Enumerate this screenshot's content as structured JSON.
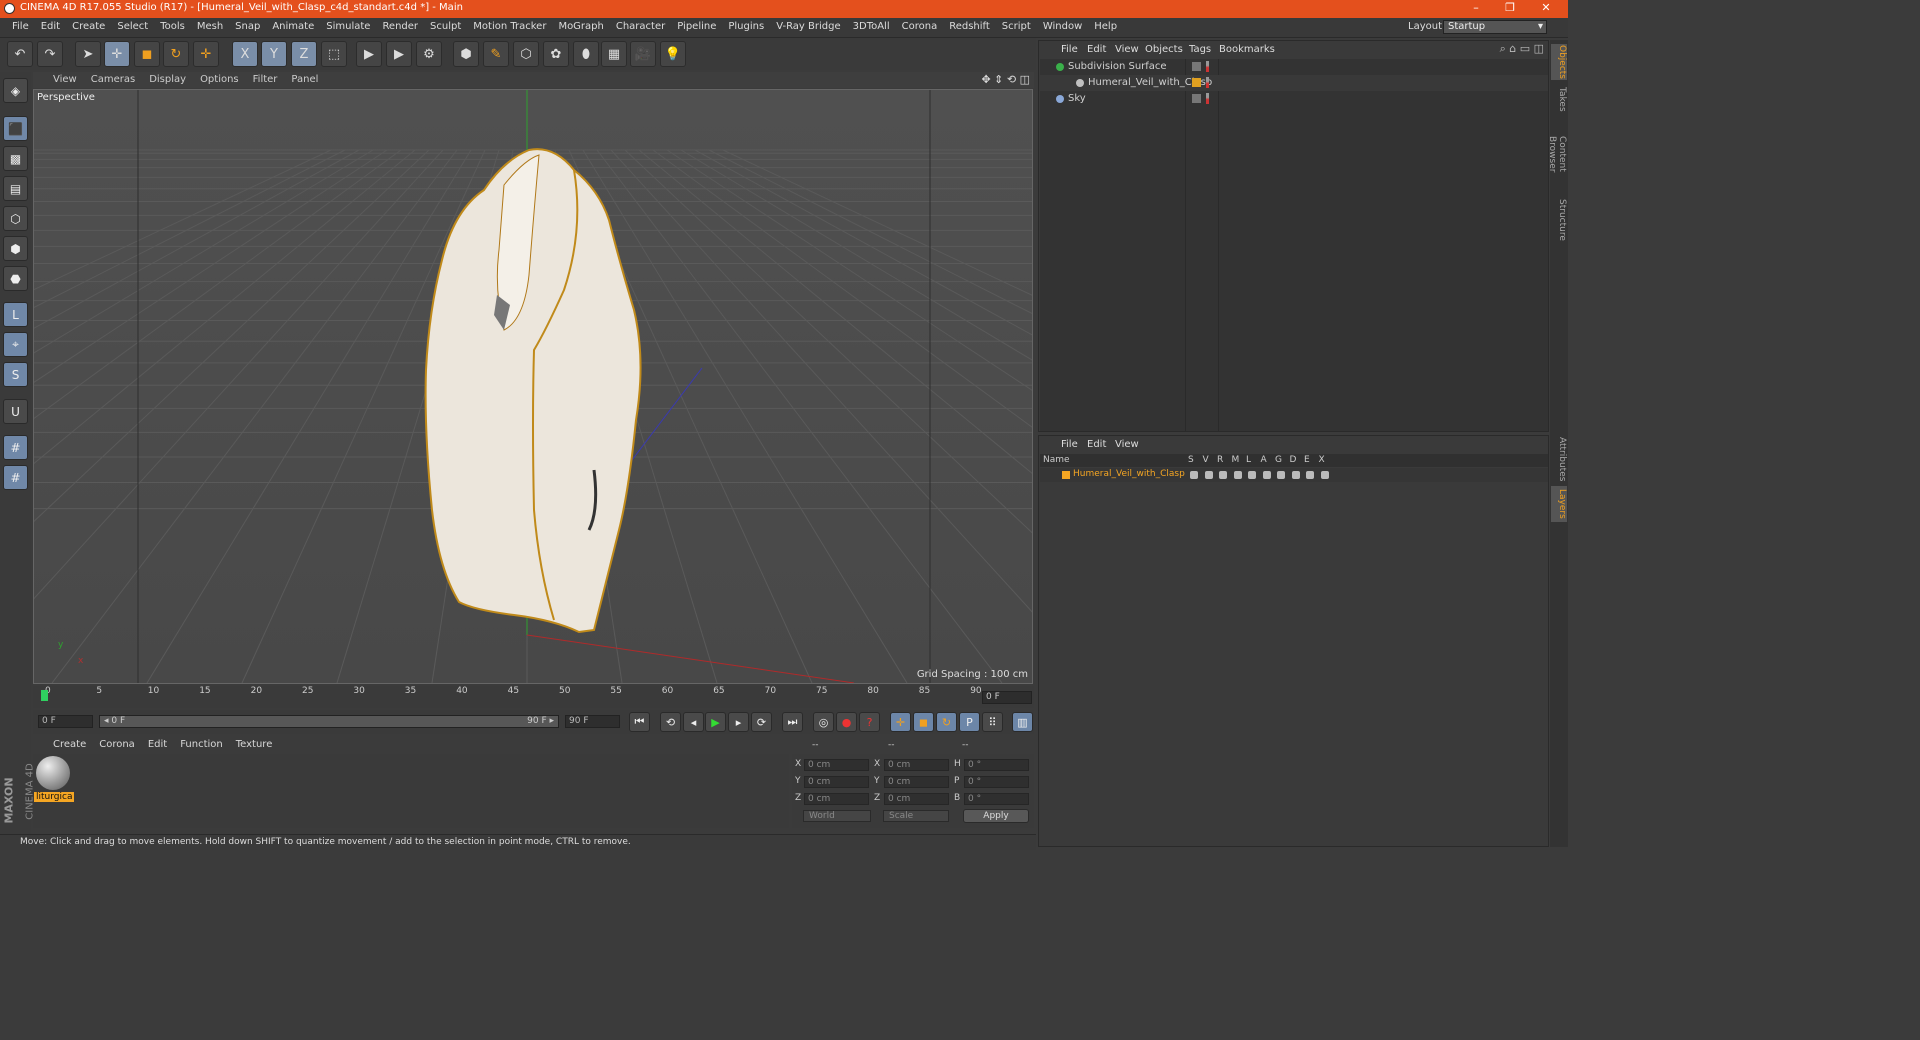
{
  "window": {
    "title": "CINEMA 4D R17.055 Studio (R17) - [Humeral_Veil_with_Clasp_c4d_standart.c4d *] - Main",
    "controls": [
      "–",
      "❐",
      "✕"
    ]
  },
  "menubar": {
    "items": [
      "File",
      "Edit",
      "Create",
      "Select",
      "Tools",
      "Mesh",
      "Snap",
      "Animate",
      "Simulate",
      "Render",
      "Sculpt",
      "Motion Tracker",
      "MoGraph",
      "Character",
      "Pipeline",
      "Plugins",
      "V-Ray Bridge",
      "3DToAll",
      "Corona",
      "Redshift",
      "Script",
      "Window",
      "Help"
    ],
    "layout_label": "Layout:",
    "layout_value": "Startup"
  },
  "toolbar": {
    "icons": [
      "undo-icon",
      "redo-icon",
      "select-icon",
      "move-icon",
      "scale-icon",
      "rotate-icon",
      "move-plus-icon",
      "x-axis-icon",
      "y-axis-icon",
      "z-axis-icon",
      "world-coord-icon",
      "render-view-icon",
      "render-picture-icon",
      "render-settings-icon",
      "cube-icon",
      "pen-icon",
      "subdivision-icon",
      "cloner-icon",
      "deformer-icon",
      "floor-icon",
      "camera-icon",
      "light-icon"
    ],
    "glyphs": [
      "↶",
      "↷",
      "➤",
      "✛",
      "◼",
      "↻",
      "✛",
      "X",
      "Y",
      "Z",
      "⬚",
      "▶",
      "▶",
      "⚙",
      "⬢",
      "✎",
      "⬡",
      "✿",
      "⬮",
      "▦",
      "🎥",
      "💡"
    ]
  },
  "lefttoolbar": {
    "icons": [
      "make-editable-icon",
      "model-mode-icon",
      "texture-mode-icon",
      "workplane-icon",
      "points-mode-icon",
      "edges-mode-icon",
      "polygons-mode-icon",
      "axis-icon",
      "tweak-icon",
      "snapping-icon",
      "magnet-icon",
      "grid-lock-icon",
      "grid-snap-icon"
    ],
    "glyphs": [
      "◈",
      "⬛",
      "▩",
      "▤",
      "⬡",
      "⬢",
      "⬣",
      "L",
      "⌖",
      "S",
      "U",
      "#",
      "#"
    ]
  },
  "viewport": {
    "menu": [
      "View",
      "Cameras",
      "Display",
      "Options",
      "Filter",
      "Panel"
    ],
    "label": "Perspective",
    "grid_spacing": "Grid Spacing : 100 cm",
    "axis_y": "y",
    "axis_x": "x"
  },
  "timeline": {
    "ticks": [
      "0",
      "5",
      "10",
      "15",
      "20",
      "25",
      "30",
      "35",
      "40",
      "45",
      "50",
      "55",
      "60",
      "65",
      "70",
      "75",
      "80",
      "85",
      "90"
    ],
    "current_frame": "0 F",
    "start_field": "0 F",
    "range_start": "◂ 0 F",
    "range_end": "90 F ▸",
    "end_field": "90 F"
  },
  "materials": {
    "menu": [
      "Create",
      "Corona",
      "Edit",
      "Function",
      "Texture"
    ],
    "items": [
      {
        "name": "liturgica"
      }
    ]
  },
  "brand": {
    "line1": "MAXON",
    "line2": "CINEMA 4D"
  },
  "coordinates": {
    "headers": [
      "--",
      "--",
      "--"
    ],
    "rows": [
      {
        "a": "X",
        "av": "0 cm",
        "b": "X",
        "bv": "0 cm",
        "c": "H",
        "cv": "0 °"
      },
      {
        "a": "Y",
        "av": "0 cm",
        "b": "Y",
        "bv": "0 cm",
        "c": "P",
        "cv": "0 °"
      },
      {
        "a": "Z",
        "av": "0 cm",
        "b": "Z",
        "bv": "0 cm",
        "c": "B",
        "cv": "0 °"
      }
    ],
    "mode1": "World",
    "mode2": "Scale",
    "apply": "Apply"
  },
  "status": {
    "text": "Move: Click and drag to move elements. Hold down SHIFT to quantize movement / add to the selection in point mode, CTRL to remove."
  },
  "objects_panel": {
    "menu": [
      "File",
      "Edit",
      "View",
      "Objects",
      "Tags",
      "Bookmarks"
    ],
    "objects": [
      {
        "name": "Subdivision Surface",
        "icon": "subdivision-icon"
      },
      {
        "name": "Humeral_Veil_with_Clasp",
        "icon": "null-icon"
      },
      {
        "name": "Sky",
        "icon": "sky-icon"
      }
    ]
  },
  "layers_panel": {
    "menu": [
      "File",
      "Edit",
      "View"
    ],
    "columns": [
      "Name",
      "S",
      "V",
      "R",
      "M",
      "L",
      "A",
      "G",
      "D",
      "E",
      "X"
    ],
    "layer_name": "Humeral_Veil_with_Clasp"
  },
  "side_tabs": [
    "Objects",
    "Takes",
    "Content Browser",
    "Structure",
    "Attributes",
    "Layers"
  ],
  "colors": {
    "titlebar": "#e4501d",
    "accent": "#f5a623",
    "selected_tool": "#7a8ea8"
  }
}
